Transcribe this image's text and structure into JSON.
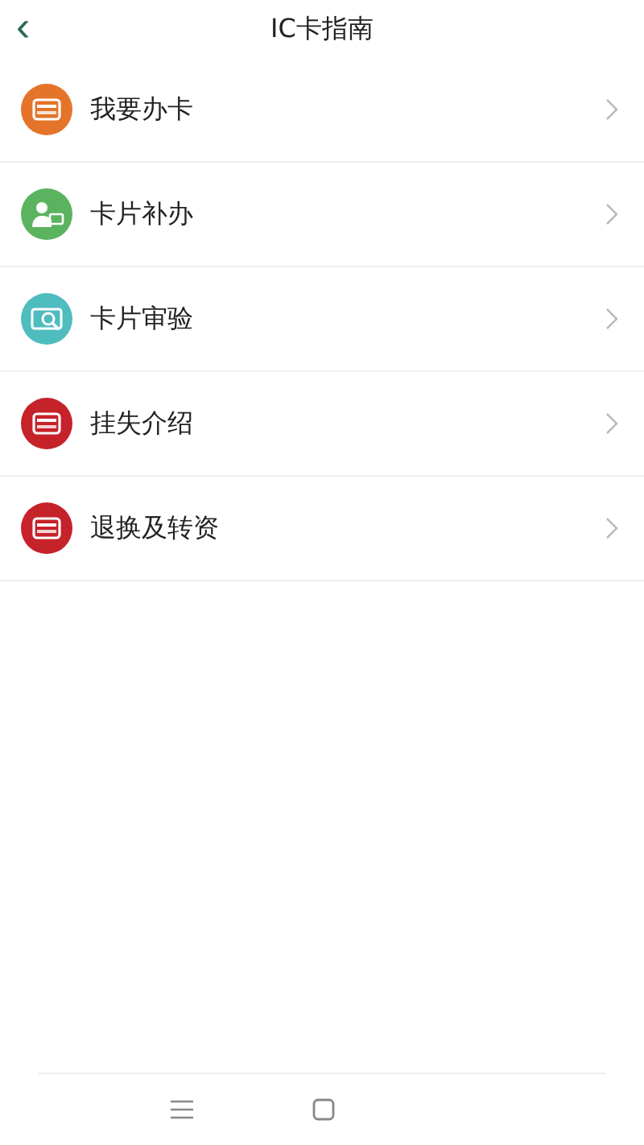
{
  "header": {
    "back": "‹",
    "title": "IC卡指南"
  },
  "items": [
    {
      "label": "我要办卡",
      "kind": "card",
      "color": "#e4742a"
    },
    {
      "label": "卡片补办",
      "kind": "person",
      "color": "#5bb35f"
    },
    {
      "label": "卡片审验",
      "kind": "inspect",
      "color": "#4fbcbf"
    },
    {
      "label": "挂失介绍",
      "kind": "card",
      "color": "#c5222a"
    },
    {
      "label": "退换及转资",
      "kind": "card",
      "color": "#c5222a"
    }
  ],
  "nav": [
    {
      "kind": "menu"
    },
    {
      "kind": "home"
    }
  ]
}
